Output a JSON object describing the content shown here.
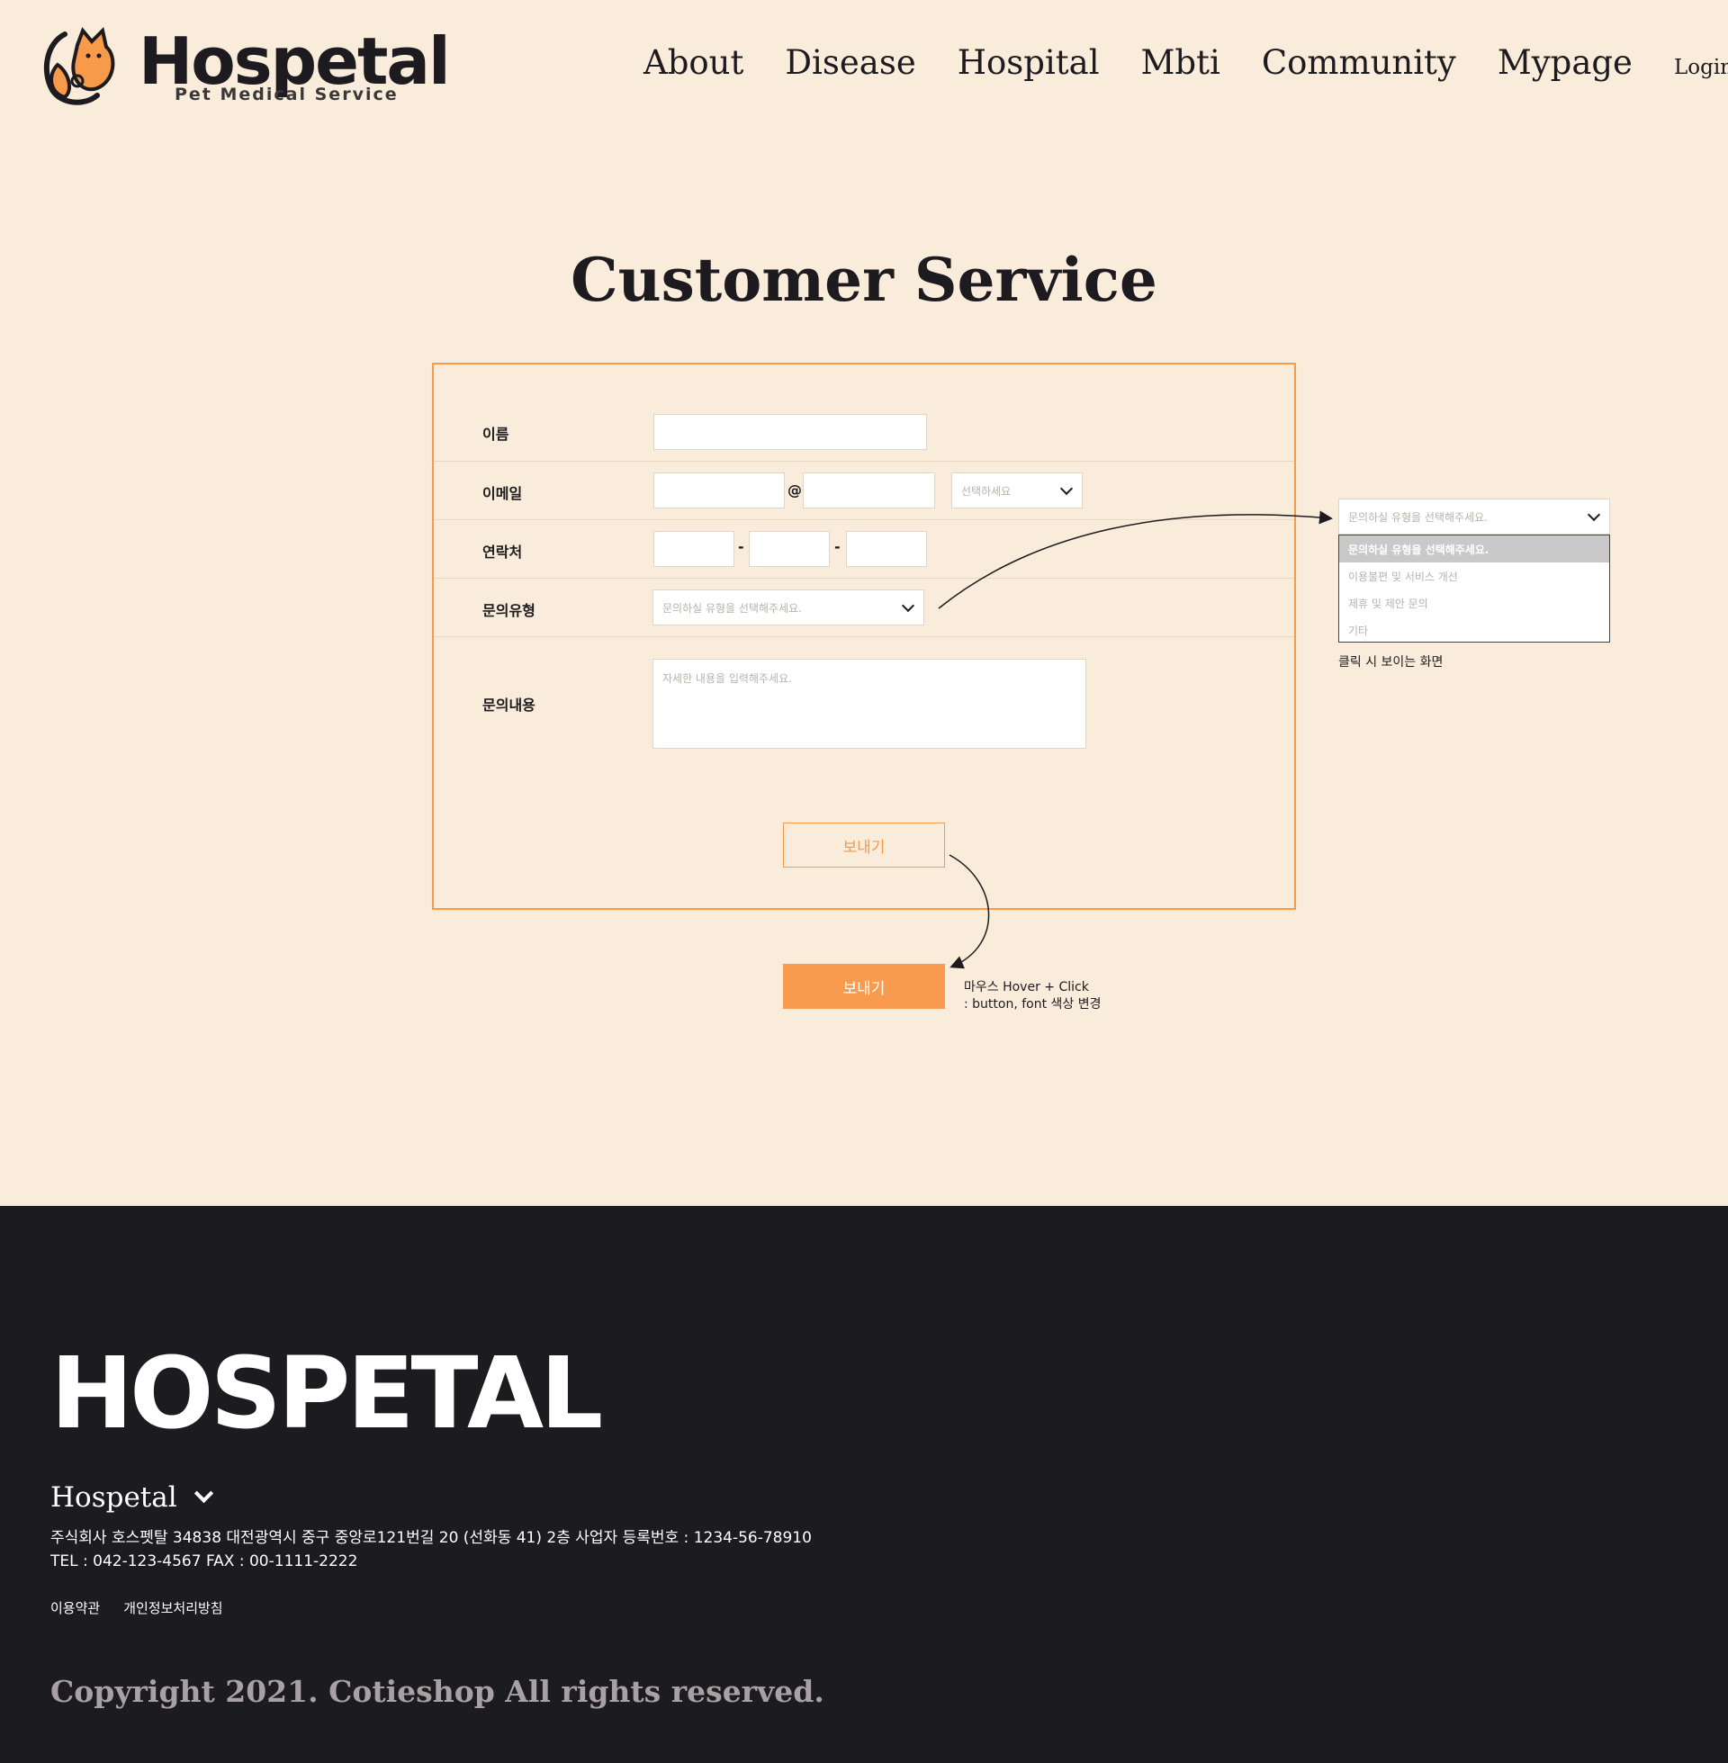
{
  "header": {
    "logo_word": "Hospetal",
    "logo_tagline": "Pet Medical Service",
    "nav": [
      "About",
      "Disease",
      "Hospital",
      "Mbti",
      "Community",
      "Mypage"
    ],
    "login": "Login"
  },
  "page_title": "Customer Service",
  "form": {
    "name_label": "이름",
    "email_label": "이메일",
    "email_at": "@",
    "email_domain_placeholder": "선택하세요",
    "phone_label": "연락처",
    "phone_sep": "-",
    "type_label": "문의유형",
    "type_placeholder": "문의하실 유형을 선택해주세요.",
    "content_label": "문의내용",
    "content_placeholder": "자세한 내용을 입력해주세요.",
    "send_label": "보내기"
  },
  "dropdown_demo": {
    "closed_value": "문의하실 유형을 선택해주세요.",
    "options": [
      "문의하실 유형을 선택해주세요.",
      "이용불편 및 서비스 개선",
      "제휴 및 제안 문의",
      "기타"
    ],
    "caption": "클릭 시 보이는 화면"
  },
  "hover_demo": {
    "send_label": "보내기",
    "note_line1": "마우스 Hover + Click",
    "note_line2": ": button, font 색상 변경"
  },
  "footer": {
    "logo_word": "HOSPETAL",
    "brand": "Hospetal",
    "address": "주식회사 호스펫탈 34838 대전광역시 중구 중앙로121번길 20 (선화동 41) 2층  사업자 등록번호 : 1234-56-78910",
    "contact": "TEL : 042-123-4567 FAX : 00-1111-2222",
    "links": [
      "이용약관",
      "개인정보처리방침"
    ],
    "copyright": "Copyright 2021. Cotieshop All rights reserved."
  },
  "colors": {
    "background": "#f9ecda",
    "accent": "#f99b4e",
    "footer_bg": "#1c1b1f"
  }
}
